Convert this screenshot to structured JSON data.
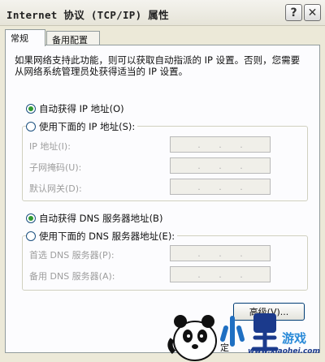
{
  "window": {
    "title": "Internet 协议 (TCP/IP) 属性",
    "help_glyph": "?",
    "close_glyph": "✕"
  },
  "tabs": [
    {
      "label": "常规"
    },
    {
      "label": "备用配置"
    }
  ],
  "description": "如果网络支持此功能，则可以获取自动指派的 IP 设置。否则，您需要从网络系统管理员处获得适当的 IP 设置。",
  "ip": {
    "auto_label": "自动获得 IP 地址(O)",
    "manual_label": "使用下面的 IP 地址(S):",
    "selected": "auto",
    "fields": [
      {
        "label": "IP 地址(I):"
      },
      {
        "label": "子网掩码(U):"
      },
      {
        "label": "默认网关(D):"
      }
    ]
  },
  "dns": {
    "auto_label": "自动获得 DNS 服务器地址(B)",
    "manual_label": "使用下面的 DNS 服务器地址(E):",
    "selected": "auto",
    "fields": [
      {
        "label": "首选 DNS 服务器(P):"
      },
      {
        "label": "备用 DNS 服务器(A):"
      }
    ]
  },
  "address_separator": ".",
  "advanced_button": "高级(V)...",
  "bottom_partial_text": "定",
  "watermark": {
    "brand": "游戏",
    "site": "www.xiaohei.com"
  },
  "colors": {
    "window_bg": "#ece9d8",
    "panel_bg": "#fcfcfe",
    "radio_dot": "#2f9a2f",
    "disabled_text": "#9d9d9d"
  }
}
